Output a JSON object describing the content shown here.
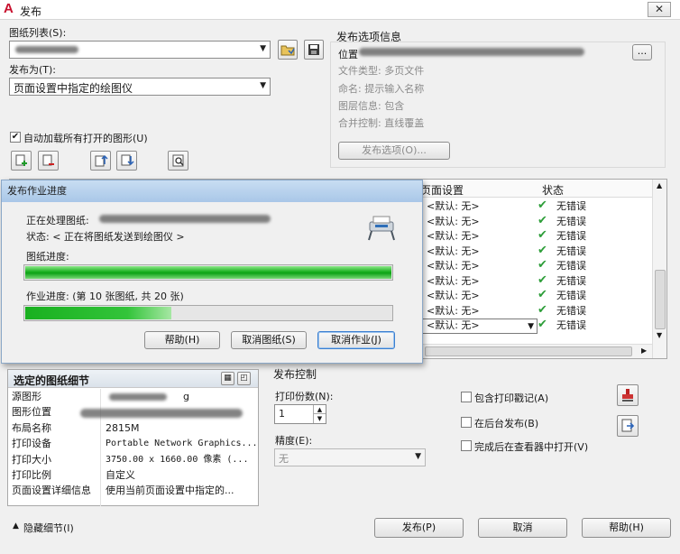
{
  "window": {
    "title": "发布",
    "close_glyph": "✕"
  },
  "sheet_list": {
    "label": "图纸列表(S):",
    "value": ""
  },
  "publish_to": {
    "label": "发布为(T):",
    "value": "页面设置中指定的绘图仪"
  },
  "auto_load": {
    "label": "自动加载所有打开的图形(U)",
    "checked": true
  },
  "options_info": {
    "title": "发布选项信息",
    "location_label": "位置",
    "file_type": "文件类型: 多页文件",
    "naming": "命名: 提示输入名称",
    "layer_info": "图层信息: 包含",
    "merge_control": "合并控制: 直线覆盖",
    "options_button": "发布选项(O)...",
    "more_button": "..."
  },
  "sheet_table": {
    "columns": [
      "页面设置",
      "状态"
    ],
    "rows": [
      {
        "setup": "<默认: 无>",
        "status": "无错误"
      },
      {
        "setup": "<默认: 无>",
        "status": "无错误"
      },
      {
        "setup": "<默认: 无>",
        "status": "无错误"
      },
      {
        "setup": "<默认: 无>",
        "status": "无错误"
      },
      {
        "setup": "<默认: 无>",
        "status": "无错误"
      },
      {
        "setup": "<默认: 无>",
        "status": "无错误"
      },
      {
        "setup": "<默认: 无>",
        "status": "无错误"
      },
      {
        "setup": "<默认: 无>",
        "status": "无错误"
      },
      {
        "setup": "<默认: 无>",
        "status": "无错误"
      }
    ]
  },
  "progress": {
    "title": "发布作业进度",
    "processing_label": "正在处理图纸:",
    "status_text": "状态: < 正在将图纸发送到绘图仪 >",
    "sheet_progress_label": "图纸进度:",
    "sheet_progress_fraction": 1.0,
    "job_progress_label": "作业进度: (第 10 张图纸, 共 20 张)",
    "job_progress_fraction": 0.5,
    "help_button": "帮助(H)",
    "cancel_sheet_button": "取消图纸(S)",
    "cancel_job_button": "取消作业(J)"
  },
  "details": {
    "title": "选定的图纸细节",
    "rows": [
      {
        "label": "源图形",
        "value": "g"
      },
      {
        "label": "图形位置",
        "value": ""
      },
      {
        "label": "布局名称",
        "value": "2815M"
      },
      {
        "label": "打印设备",
        "value": "Portable Network Graphics..."
      },
      {
        "label": "打印大小",
        "value": "3750.00 x 1660.00 像素 (..."
      },
      {
        "label": "打印比例",
        "value": "自定义"
      },
      {
        "label": "页面设置详细信息",
        "value": "使用当前页面设置中指定的..."
      }
    ]
  },
  "publish_control": {
    "title": "发布控制",
    "copies_label": "打印份数(N):",
    "copies_value": "1",
    "precision_label": "精度(E):",
    "precision_value": "无",
    "include_stamp": {
      "label": "包含打印戳记(A)",
      "checked": false
    },
    "background": {
      "label": "在后台发布(B)",
      "checked": false
    },
    "open_viewer": {
      "label": "完成后在查看器中打开(V)",
      "checked": false
    }
  },
  "footer": {
    "hide_details": "隐藏细节(I)",
    "publish_button": "发布(P)",
    "cancel_button": "取消",
    "help_button": "帮助(H)"
  },
  "colors": {
    "progress_green": "#19b01f",
    "title_blue": "#a9c7e8",
    "ok_green": "#2e9e3a"
  }
}
